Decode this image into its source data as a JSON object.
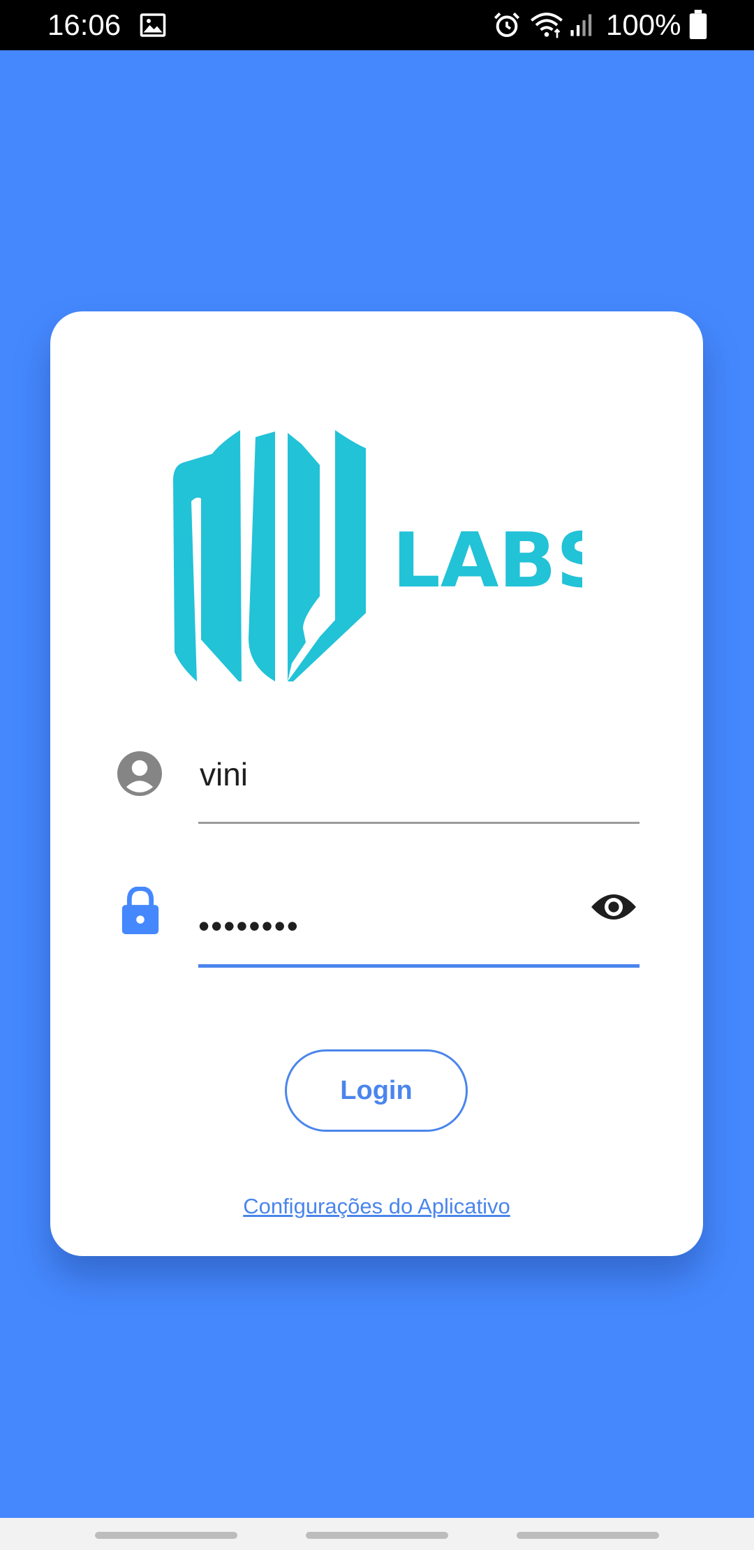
{
  "status_bar": {
    "time": "16:06",
    "battery": "100%",
    "icons": [
      "image-icon",
      "alarm-icon",
      "wifi-icon",
      "signal-icon",
      "battery-icon"
    ]
  },
  "logo": {
    "text": "LABS",
    "color": "#22c2d7"
  },
  "login_form": {
    "username_value": "vini",
    "password_value": "••••••••",
    "login_label": "Login",
    "settings_link": "Configurações do Aplicativo"
  },
  "colors": {
    "background": "#4588fd",
    "accent": "#4a85ec",
    "card": "#ffffff",
    "logo": "#22c2d7"
  }
}
